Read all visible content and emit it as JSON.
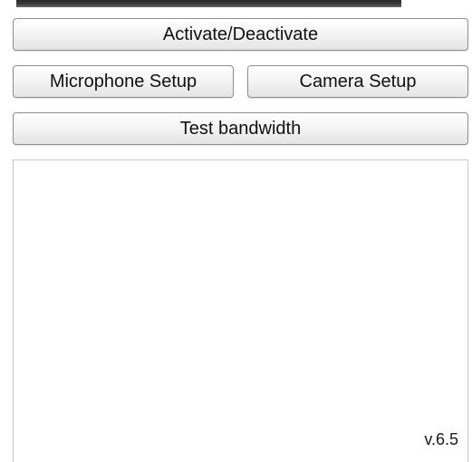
{
  "buttons": {
    "activate_label": "Activate/Deactivate",
    "microphone_label": "Microphone Setup",
    "camera_label": "Camera Setup",
    "bandwidth_label": "Test bandwidth"
  },
  "panel": {
    "version": "v.6.5"
  }
}
